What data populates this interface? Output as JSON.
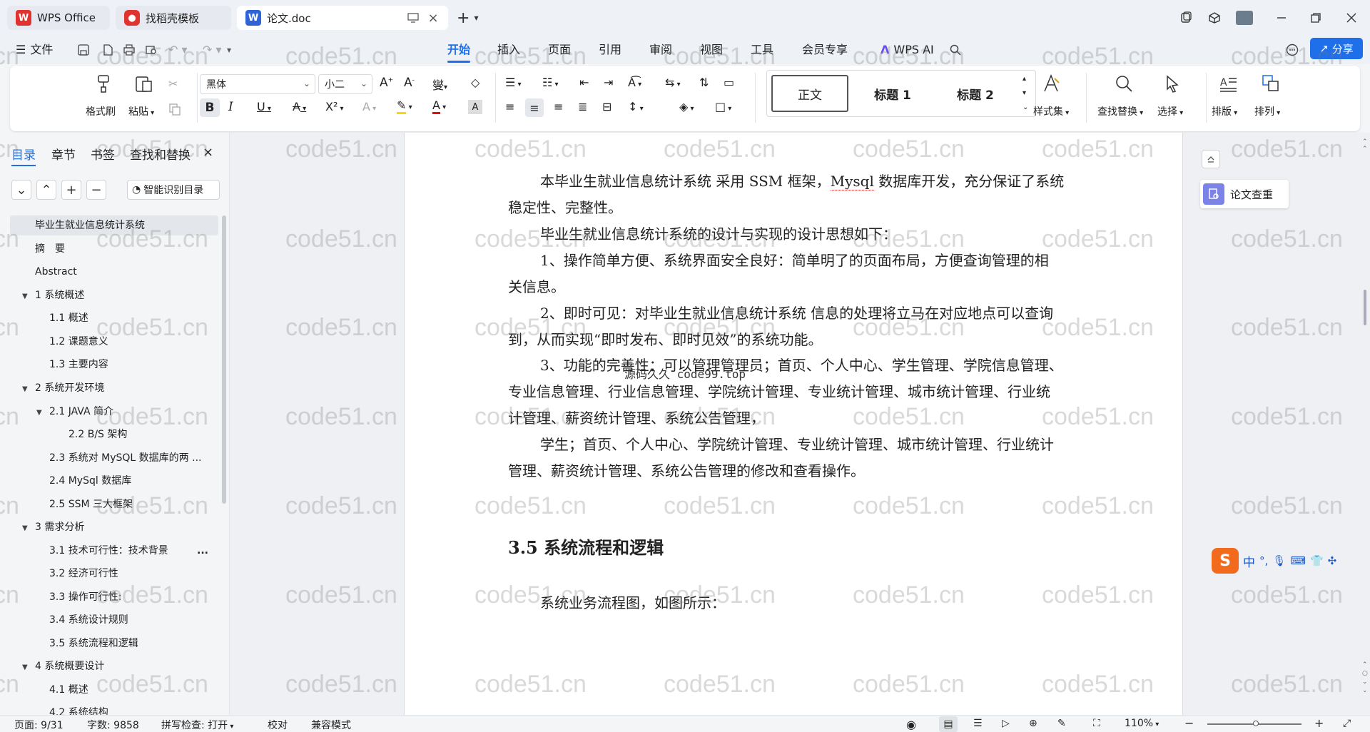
{
  "tabs": [
    {
      "label": "WPS Office"
    },
    {
      "label": "找稻壳模板"
    },
    {
      "label": "论文.doc"
    }
  ],
  "menu": {
    "file": "文件",
    "items": [
      "开始",
      "插入",
      "页面",
      "引用",
      "审阅",
      "视图",
      "工具",
      "会员专享"
    ],
    "wps_ai": "WPS AI",
    "share": "分享"
  },
  "ribbon": {
    "format_painter": "格式刷",
    "paste": "粘贴",
    "font_name": "黑体",
    "font_size": "小二",
    "styles": [
      "正文",
      "标题 1",
      "标题 2"
    ],
    "style_set": "样式集",
    "find_replace": "查找替换",
    "select": "选择",
    "layout": "排版",
    "arrange": "排列"
  },
  "leftpane": {
    "tabs": [
      "目录",
      "章节",
      "书签",
      "查找和替换"
    ],
    "smart_toc": "智能识别目录",
    "toc": [
      "毕业生就业信息统计系统",
      "摘　要",
      "Abstract",
      "1 系统概述",
      "1.1 概述",
      "1.2 课题意义",
      "1.3 主要内容",
      "2 系统开发环境",
      "2.1 JAVA 简介",
      "2.2 B/S 架构",
      "2.3 系统对 MySQL 数据库的两 ...",
      "2.4 MySql 数据库",
      "2.5 SSM 三大框架",
      "3 需求分析",
      "3.1 技术可行性：技术背景",
      "3.2 经济可行性",
      "3.3 操作可行性:",
      "3.4 系统设计规则",
      "3.5 系统流程和逻辑",
      "4 系统概要设计",
      "4.1 概述",
      "4.2 系统结构"
    ],
    "more": "..."
  },
  "document": {
    "lines": [
      {
        "pre": "本毕业生就业信息统计系统 采用 SSM 框架，",
        "mark": "Mysql",
        "post": " 数据库开发，充分保证了系统"
      },
      {
        "pre": "稳定性、完整性。"
      },
      {
        "pre": "毕业生就业信息统计系统的设计与实现的设计思想如下："
      },
      {
        "pre": "1、操作简单方便、系统界面安全良好：简单明了的页面布局，方便查询管理的相"
      },
      {
        "pre": "关信息。"
      },
      {
        "pre": "2、即时可见：对毕业生就业信息统计系统 信息的处理将立马在对应地点可以查询"
      },
      {
        "pre": "到，从而实现“即时发布、即时见效”的系统功能。"
      },
      {
        "pre": "3、功能的完善性：可以管理管理员；首页、个人中心、学生管理、学院信息管理、"
      },
      {
        "pre": "专业信息管理、行业信息管理、学院统计管理、专业统计管理、城市统计管理、行业统"
      },
      {
        "pre": "计管理、薪资统计管理、系统公告管理，"
      },
      {
        "pre": "学生；首页、个人中心、学院统计管理、专业统计管理、城市统计管理、行业统计"
      },
      {
        "pre": "管理、薪资统计管理、系统公告管理的修改和查看操作。"
      }
    ],
    "watermark_line": "源码久久 code99.top",
    "heading": "3.5 系统流程和逻辑",
    "caption_line": "系统业务流程图，如图所示："
  },
  "rightpanel": {
    "paper_check": "论文查重"
  },
  "ime": {
    "lang": "中"
  },
  "statusbar": {
    "page": "页面: 9/31",
    "words": "字数: 9858",
    "spell": "拼写检查: 打开",
    "proof": "校对",
    "compat": "兼容模式",
    "zoom": "110%"
  },
  "watermark": "code51.cn",
  "colors": {
    "accent": "#1f6feb",
    "wps_red": "#e0322f",
    "doc_blue": "#2f64d8"
  }
}
